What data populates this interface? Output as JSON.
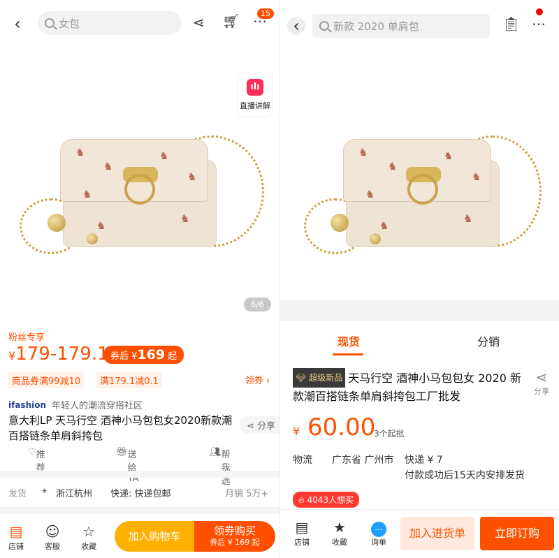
{
  "left": {
    "search_placeholder": "女包",
    "cart_badge": "15",
    "live": {
      "label": "直播讲解"
    },
    "pager": "6/6",
    "fans_only": "粉丝专享",
    "price": {
      "currency": "¥",
      "range": "179-179.1"
    },
    "coupon_price": {
      "prefix": "券后 ¥",
      "value": "169",
      "suffix": "起"
    },
    "coupons": [
      "商品券满99减10",
      "满179.1减0.1"
    ],
    "get_coupon": "领券 ›",
    "brand": {
      "logo": "ifashion",
      "slogan": "年轻人的潮流穿搭社区"
    },
    "title": "意大利LP 天马行空 酒神小马包包女2020新款潮百搭链条单肩斜挎包",
    "share": "分享",
    "actions": {
      "recommend": "推荐",
      "gift": "送给TA",
      "help": "帮我选"
    },
    "shipping": {
      "label": "发货",
      "location": "浙江杭州",
      "express": "快递: 快递包邮",
      "sales": "月销 5万+"
    },
    "bottom": {
      "store": "店铺",
      "service": "客服",
      "favorite": "收藏",
      "add_cart": "加入购物车",
      "buy_label": "领券购买",
      "buy_sub": "券后 ¥ 169 起"
    }
  },
  "right": {
    "search_placeholder": "新款 2020 单肩包",
    "tabs": [
      "现货",
      "分销"
    ],
    "new_tag": "超级新品",
    "title": "天马行空 酒神小马包包女 2020 新款潮百搭链条单肩斜挎包工厂批发",
    "share": "分享",
    "price": {
      "currency": "¥",
      "value": "60.00"
    },
    "moq": "3个起批",
    "logistics": {
      "label": "物流",
      "from": "广东省 广州市",
      "fee": "快递 ¥ 7",
      "note": "付款成功后15天内安排发货"
    },
    "hot": "4043人想买",
    "bottom": {
      "store": "店铺",
      "favorite": "收藏",
      "inquiry": "询单",
      "add_cart": "加入进货单",
      "buy": "立即订购"
    }
  },
  "colors": {
    "accent": "#ff5000",
    "accent_light": "#fff2ea",
    "yellow": "#ffb000"
  }
}
